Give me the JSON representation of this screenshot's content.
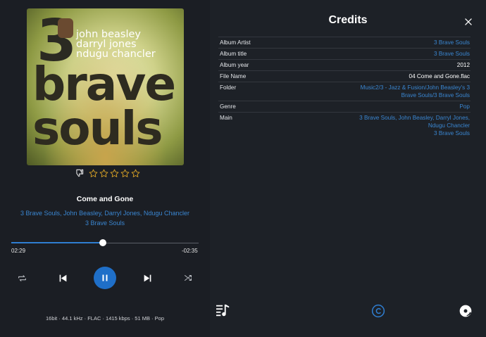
{
  "album_cover": {
    "number": "3",
    "names": [
      "john beasley",
      "darryl jones",
      "ndugu chancler"
    ],
    "word1": "brave",
    "word2": "souls"
  },
  "rating": {
    "thumb_icon": "thumbs-down-icon",
    "stars_filled": 0,
    "stars_total": 5,
    "star_color": "#e0a825"
  },
  "now_playing": {
    "title": "Come and Gone",
    "artists": "3 Brave Souls, John Beasley, Darryl Jones, Ndugu Chancler",
    "album": "3 Brave Souls"
  },
  "progress": {
    "elapsed": "02:29",
    "remaining": "-02:35",
    "fraction": 0.49
  },
  "controls": {
    "repeat_icon": "repeat-icon",
    "previous_icon": "skip-previous-icon",
    "pause_icon": "pause-icon",
    "next_icon": "skip-next-icon",
    "shuffle_icon": "shuffle-icon"
  },
  "file_info": "16bit · 44.1 kHz · FLAC · 1415 kbps · 51 MB · Pop",
  "credits": {
    "title": "Credits",
    "close_icon": "close-icon",
    "rows": [
      {
        "label": "Album  Artist",
        "value": [
          "3 Brave Souls"
        ],
        "link": true
      },
      {
        "label": "Album title",
        "value": [
          "3 Brave Souls"
        ],
        "link": true
      },
      {
        "label": "Album year",
        "value": [
          "2012"
        ],
        "link": false
      },
      {
        "label": "File  Name",
        "value": [
          "04 Come and Gone.flac"
        ],
        "link": false
      },
      {
        "label": "Folder",
        "value": [
          "Music2/3 - Jazz & Fusion/John Beasley's 3",
          "Brave Souls/3 Brave Souls"
        ],
        "link": true
      },
      {
        "label": "Genre",
        "value": [
          "Pop"
        ],
        "link": true
      },
      {
        "label": "Main",
        "value": [
          "3 Brave Souls, John Beasley, Darryl Jones,",
          "Ndugu Chancler",
          "3 Brave Souls"
        ],
        "link": true
      }
    ]
  },
  "bottom_tabs": {
    "lyrics_icon": "lyrics-icon",
    "credits_icon": "copyright-icon",
    "disc_icon": "disc-icon"
  },
  "colors": {
    "accent": "#2f7ed1",
    "link": "#3a86d1",
    "background": "#1c1f25"
  }
}
